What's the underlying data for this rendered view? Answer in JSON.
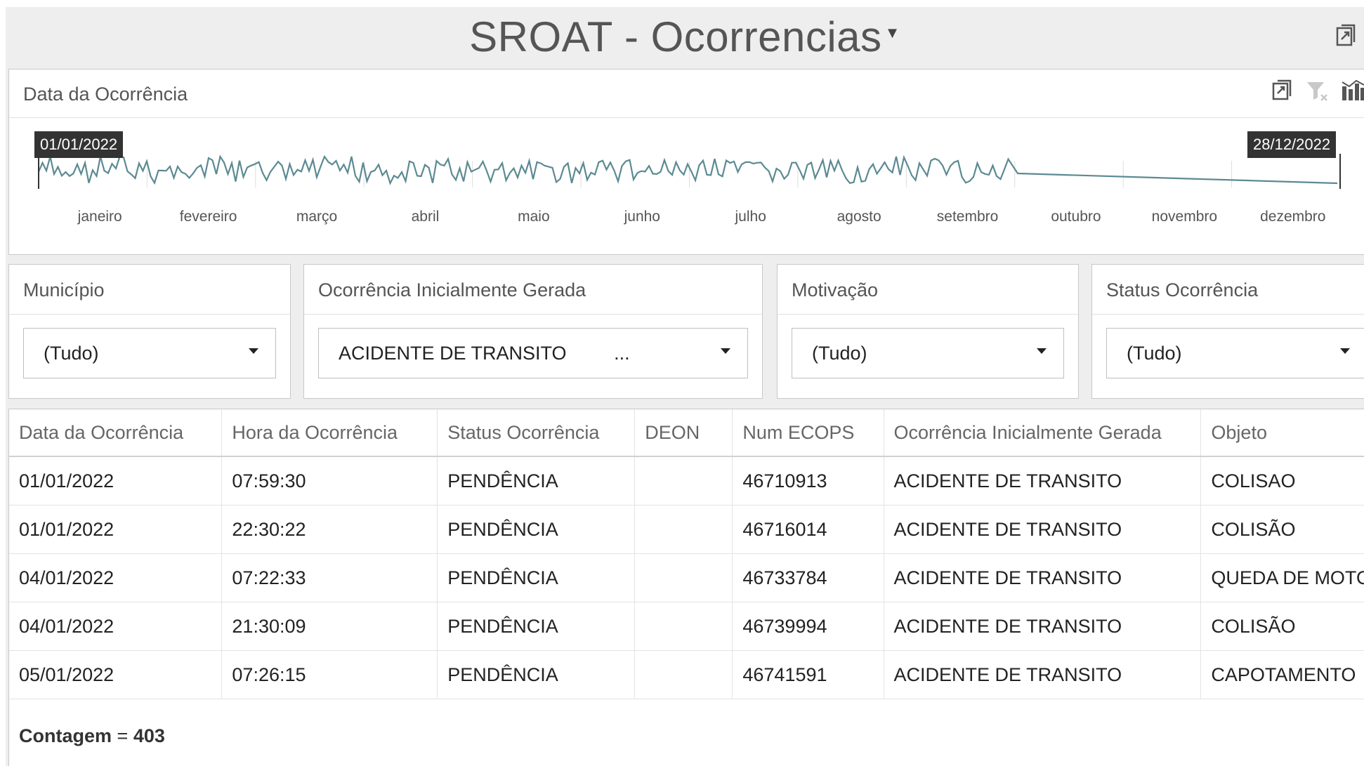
{
  "header": {
    "title": "SROAT - Ocorrencias",
    "title_caret": "▼"
  },
  "date_panel": {
    "title": "Data da Ocorrência",
    "start_date": "01/01/2022",
    "end_date": "28/12/2022",
    "months": [
      "janeiro",
      "fevereiro",
      "março",
      "abril",
      "maio",
      "junho",
      "julho",
      "agosto",
      "setembro",
      "outubro",
      "novembro",
      "dezembro"
    ],
    "line_color": "#5b8a92"
  },
  "filters": [
    {
      "label": "Município",
      "value": "(Tudo)"
    },
    {
      "label": "Ocorrência Inicialmente Gerada",
      "value": "ACIDENTE DE TRANSITO         ..."
    },
    {
      "label": "Motivação",
      "value": "(Tudo)"
    },
    {
      "label": "Status Ocorrência",
      "value": "(Tudo)"
    }
  ],
  "table": {
    "columns": [
      "Data da Ocorrência",
      "Hora da Ocorrência",
      "Status Ocorrência",
      "DEON",
      "Num ECOPS",
      "Ocorrência Inicialmente Gerada",
      "Objeto"
    ],
    "rows": [
      [
        "01/01/2022",
        "07:59:30",
        "PENDÊNCIA",
        "",
        "46710913",
        "ACIDENTE DE TRANSITO",
        "COLISAO"
      ],
      [
        "01/01/2022",
        "22:30:22",
        "PENDÊNCIA",
        "",
        "46716014",
        "ACIDENTE DE TRANSITO",
        "COLISÃO"
      ],
      [
        "04/01/2022",
        "07:22:33",
        "PENDÊNCIA",
        "",
        "46733784",
        "ACIDENTE DE TRANSITO",
        "QUEDA DE MOTO"
      ],
      [
        "04/01/2022",
        "21:30:09",
        "PENDÊNCIA",
        "",
        "46739994",
        "ACIDENTE DE TRANSITO",
        "COLISÃO"
      ],
      [
        "05/01/2022",
        "07:26:15",
        "PENDÊNCIA",
        "",
        "46741591",
        "ACIDENTE DE TRANSITO",
        "CAPOTAMENTO"
      ]
    ],
    "footer_label": "Contagem",
    "footer_sep": "=",
    "footer_value": "403"
  },
  "icons": [
    "export-icon",
    "clear-filter-icon",
    "chart-icon",
    "dropdown-caret-icon"
  ]
}
